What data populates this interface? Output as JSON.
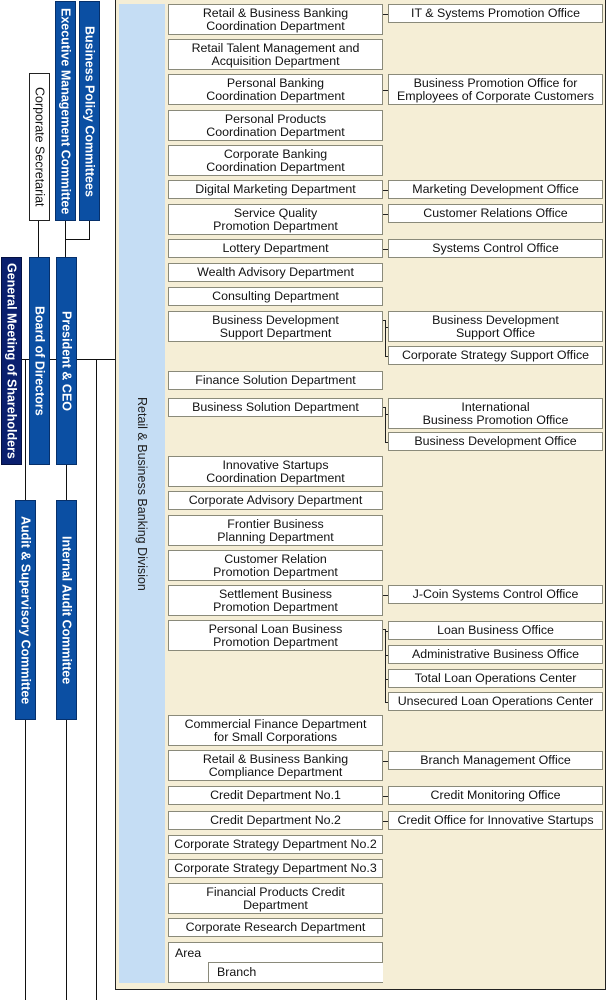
{
  "governance": {
    "business_policy_committees": "Business Policy Committees",
    "executive_management_committee": "Executive Management Committee",
    "corporate_secretariat": "Corporate Secretariat",
    "general_meeting": "General Meeting of Shareholders",
    "board_of_directors": "Board of Directors",
    "president_ceo": "President & CEO",
    "audit_supervisory_committee": "Audit & Supervisory Committee",
    "internal_audit_committee": "Internal Audit Committee"
  },
  "division": {
    "name": "Retail & Business Banking Division"
  },
  "departments": [
    {
      "name": "Retail & Business Banking\nCoordination Department",
      "offices": [
        "IT & Systems Promotion Office"
      ]
    },
    {
      "name": "Retail Talent Management and\nAcquisition Department",
      "offices": []
    },
    {
      "name": "Personal Banking\nCoordination Department",
      "offices": [
        "Business Promotion Office for\nEmployees of Corporate Customers"
      ]
    },
    {
      "name": "Personal Products\nCoordination Department",
      "offices": []
    },
    {
      "name": "Corporate Banking\nCoordination Department",
      "offices": []
    },
    {
      "name": "Digital Marketing Department",
      "offices": [
        "Marketing Development Office"
      ]
    },
    {
      "name": "Service Quality\nPromotion Department",
      "offices": [
        "Customer Relations Office"
      ]
    },
    {
      "name": "Lottery Department",
      "offices": [
        "Systems Control Office"
      ]
    },
    {
      "name": "Wealth Advisory Department",
      "offices": []
    },
    {
      "name": "Consulting Department",
      "offices": []
    },
    {
      "name": "Business Development\nSupport Department",
      "offices": [
        "Business Development\nSupport Office",
        "Corporate Strategy Support Office"
      ]
    },
    {
      "name": "Finance Solution Department",
      "offices": []
    },
    {
      "name": "Business Solution Department",
      "offices": [
        "International\nBusiness Promotion Office",
        "Business Development Office"
      ]
    },
    {
      "name": "Innovative Startups\nCoordination Department",
      "offices": []
    },
    {
      "name": "Corporate Advisory Department",
      "offices": []
    },
    {
      "name": "Frontier Business\nPlanning Department",
      "offices": []
    },
    {
      "name": "Customer Relation\nPromotion Department",
      "offices": []
    },
    {
      "name": "Settlement Business\nPromotion Department",
      "offices": [
        "J-Coin Systems Control Office"
      ]
    },
    {
      "name": "Personal Loan Business\nPromotion Department",
      "offices": [
        "Loan Business Office",
        "Administrative Business Office",
        "Total Loan Operations Center",
        "Unsecured Loan Operations Center"
      ]
    },
    {
      "name": "Commercial Finance Department\nfor Small Corporations",
      "offices": []
    },
    {
      "name": "Retail & Business Banking\nCompliance Department",
      "offices": [
        "Branch Management Office"
      ]
    },
    {
      "name": "Credit Department No.1",
      "offices": [
        "Credit Monitoring Office"
      ]
    },
    {
      "name": "Credit Department No.2",
      "offices": [
        "Credit Office for Innovative Startups"
      ]
    },
    {
      "name": "Corporate Strategy Department No.2",
      "offices": []
    },
    {
      "name": "Corporate Strategy Department No.3",
      "offices": []
    },
    {
      "name": "Financial Products Credit\nDepartment",
      "offices": []
    },
    {
      "name": "Corporate Research Department",
      "offices": []
    }
  ],
  "area": {
    "area_label": "Area",
    "branch_label": "Branch"
  }
}
